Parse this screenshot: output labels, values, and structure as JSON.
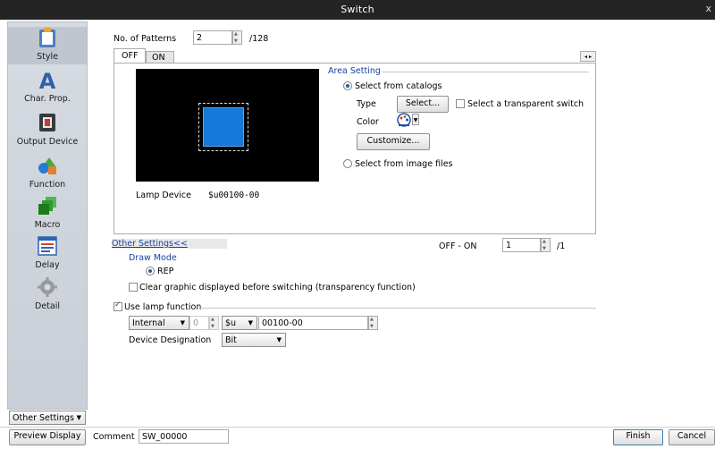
{
  "window": {
    "title": "Switch",
    "close": "x"
  },
  "sidebar": {
    "items": [
      {
        "label": "Style",
        "icon": "style-icon"
      },
      {
        "label": "Char. Prop.",
        "icon": "char-prop-icon"
      },
      {
        "label": "Output Device",
        "icon": "output-device-icon"
      },
      {
        "label": "Function",
        "icon": "function-icon"
      },
      {
        "label": "Macro",
        "icon": "macro-icon"
      },
      {
        "label": "Delay",
        "icon": "delay-icon"
      },
      {
        "label": "Detail",
        "icon": "detail-icon"
      }
    ],
    "other_settings": "Other Settings"
  },
  "patterns": {
    "label": "No. of Patterns",
    "value": "2",
    "max": "/128"
  },
  "tabs": [
    {
      "label": "OFF"
    },
    {
      "label": "ON"
    }
  ],
  "preview": {
    "lamp_device_label": "Lamp Device",
    "lamp_device_value": "$u00100-00"
  },
  "area": {
    "title": "Area Setting",
    "from_catalogs": "Select from catalogs",
    "type_label": "Type",
    "select_button": "Select...",
    "transparent_label": "Select a transparent switch",
    "color_label": "Color",
    "customize_button": "Customize...",
    "from_files": "Select from image files"
  },
  "other": {
    "link": "Other Settings<<",
    "off_on_label": "OFF - ON",
    "off_on_value": "1",
    "off_on_max": "/1",
    "draw_mode_label": "Draw Mode",
    "draw_mode_option": "REP",
    "clear_graphic": "Clear graphic displayed before switching (transparency function)"
  },
  "lamp": {
    "use_label": "Use lamp function",
    "type": "Internal",
    "index": "0",
    "device": "$u",
    "address": "00100-00",
    "designation_label": "Device Designation",
    "designation": "Bit"
  },
  "footer": {
    "preview_button": "Preview Display",
    "comment_label": "Comment",
    "comment_value": "SW_00000",
    "finish_button": "Finish",
    "cancel_button": "Cancel"
  },
  "colors": {
    "switch_blue": "#1479d8",
    "preview_bg": "#000000",
    "link_blue": "#1b3fa4"
  }
}
